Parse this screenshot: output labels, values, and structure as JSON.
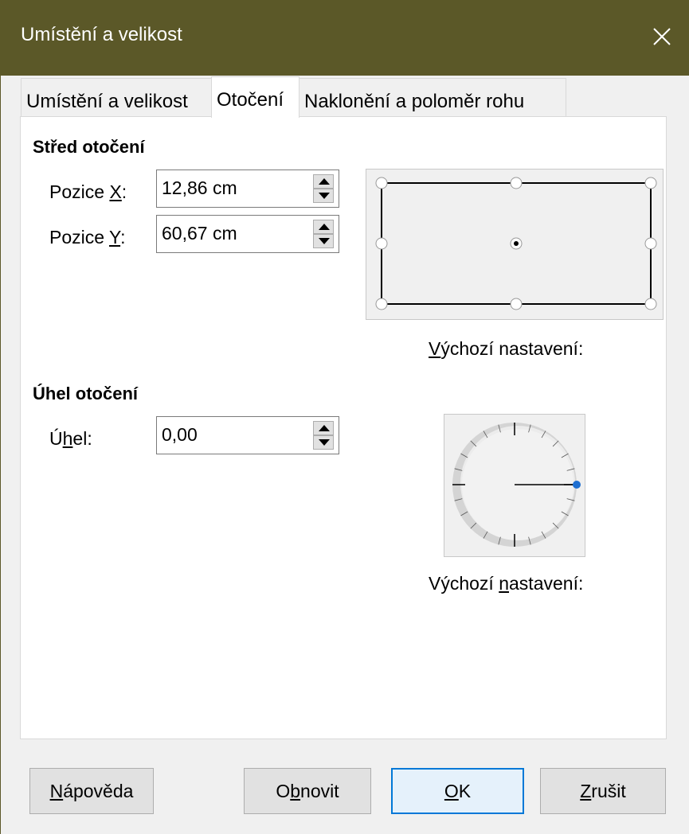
{
  "window": {
    "title": "Umístění a velikost"
  },
  "tabs": [
    {
      "label": "Umístění a velikost",
      "active": false
    },
    {
      "label": "Otočení",
      "active": true
    },
    {
      "label": "Naklonění a poloměr rohu",
      "active": false
    }
  ],
  "rotation_center": {
    "heading": "Střed otočení",
    "pos_x": {
      "label_pre": "Pozice ",
      "label_mnemonic": "X",
      "label_post": ":",
      "value": "12,86 cm"
    },
    "pos_y": {
      "label_pre": "Pozice ",
      "label_mnemonic": "Y",
      "label_post": ":",
      "value": "60,67 cm"
    },
    "defaults": {
      "mnemonic": "V",
      "rest": "ýchozí nastavení:"
    }
  },
  "rotation_angle": {
    "heading": "Úhel otočení",
    "angle": {
      "label_pre": "Ú",
      "label_mnemonic": "h",
      "label_post": "el:",
      "value": "0,00"
    },
    "defaults": {
      "pre": "Výchozí ",
      "mnemonic": "n",
      "rest": "astavení:"
    },
    "angle_degrees": 0
  },
  "buttons": {
    "help": {
      "mnemonic": "N",
      "rest": "ápověda"
    },
    "reset": {
      "pre": "O",
      "mnemonic": "b",
      "rest": "novit"
    },
    "ok": {
      "mnemonic": "O",
      "rest": "K"
    },
    "cancel": {
      "mnemonic": "Z",
      "rest": "rušit"
    }
  },
  "colors": {
    "titlebar": "#5b5828",
    "accent": "#0078d7",
    "dial_handle": "#1f6fd1"
  }
}
